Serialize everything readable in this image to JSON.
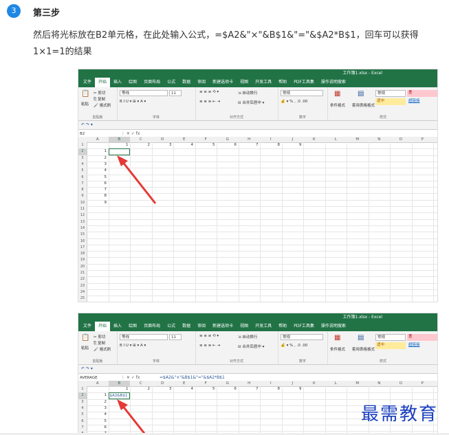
{
  "step": {
    "number": "3",
    "title": "第三步",
    "desc_line1": "然后将光标放在B2单元格，在此处输入公式，=$A2&\"×\"&B$1&\"=\"&$A2*B$1，回车可以获得",
    "desc_line2": "1×1=1的结果"
  },
  "excel": {
    "window_title": "工作簿1.xlsx - Excel",
    "tabs": [
      "文件",
      "开始",
      "插入",
      "绘图",
      "页面布局",
      "公式",
      "数据",
      "审阅",
      "新建选项卡",
      "视图",
      "开发工具",
      "帮助",
      "PDF工具集",
      "操作说明搜索"
    ],
    "ribbon": {
      "paste": "粘贴",
      "cut": "剪切",
      "copy": "复制",
      "format_painter": "格式刷",
      "clipboard": "剪贴板",
      "font_name": "等线",
      "font_size": "11",
      "font": "字体",
      "wrap_text": "自动换行",
      "merge_center": "合并后居中",
      "alignment": "对齐方式",
      "number_format": "常规",
      "number": "数字",
      "conditional_format": "条件格式",
      "table_format": "套用表格格式",
      "style_normal": "常规",
      "style_bad": "差",
      "style_neutral": "适中",
      "style_hyperlink": "超链接",
      "styles": "样式"
    },
    "shot1": {
      "name_box": "B2",
      "formula": ""
    },
    "shot2": {
      "name_box": "AVERAGE",
      "formula": "=$A2&\"×\"&B$1&\"=\"&$A2*B$1",
      "edit_text": "$A2&B$1"
    },
    "columns": [
      "A",
      "B",
      "C",
      "D",
      "E",
      "F",
      "G",
      "H",
      "I",
      "J",
      "K",
      "L",
      "M",
      "N",
      "O",
      "P"
    ],
    "row1_values": [
      "1",
      "2",
      "3",
      "4",
      "5",
      "6",
      "7",
      "8",
      "9"
    ],
    "colA_values": [
      "1",
      "2",
      "3",
      "4",
      "5",
      "6",
      "7",
      "8",
      "9"
    ],
    "row_numbers": [
      "1",
      "2",
      "3",
      "4",
      "5",
      "6",
      "7",
      "8",
      "9",
      "10",
      "11",
      "12",
      "13",
      "14",
      "15",
      "16",
      "17",
      "18",
      "19",
      "20",
      "21",
      "22",
      "23",
      "24",
      "25"
    ]
  },
  "watermark": "最需教育"
}
